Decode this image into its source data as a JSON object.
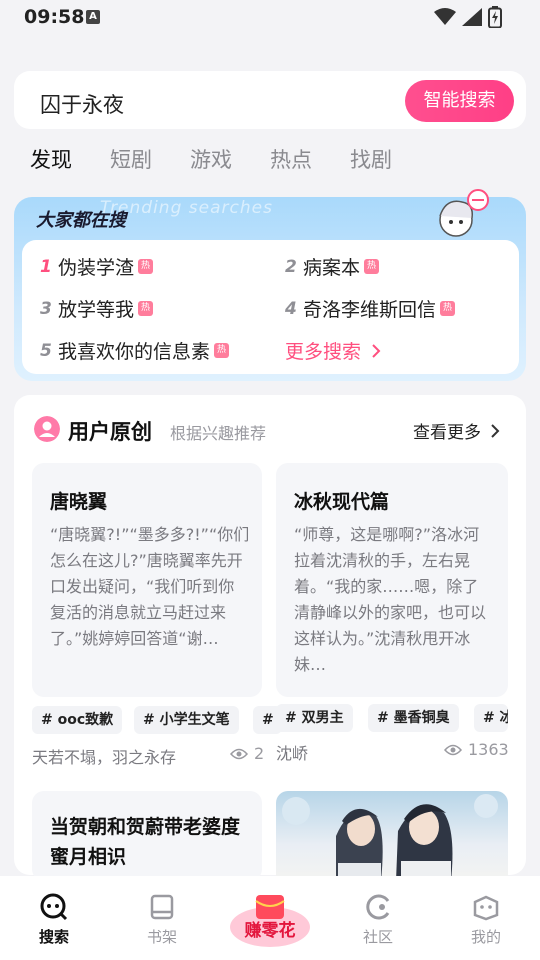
{
  "status": {
    "time": "09:58",
    "a_badge": "A"
  },
  "search": {
    "query": "囚于永夜",
    "button": "智能搜索"
  },
  "tabs": [
    "发现",
    "短剧",
    "游戏",
    "热点",
    "找剧"
  ],
  "trending": {
    "title": "大家都在搜",
    "ghost": "Trending searches",
    "hot_badge": "热",
    "items": [
      {
        "rank": "1",
        "text": "伪装学渣"
      },
      {
        "rank": "2",
        "text": "病案本"
      },
      {
        "rank": "3",
        "text": "放学等我"
      },
      {
        "rank": "4",
        "text": "奇洛李维斯回信"
      },
      {
        "rank": "5",
        "text": "我喜欢你的信息素"
      }
    ],
    "more": "更多搜索"
  },
  "creation": {
    "title": "用户原创",
    "subtitle": "根据兴趣推荐",
    "see_more": "查看更多",
    "stories": [
      {
        "title": "唐晓翼",
        "body": "“唐晓翼?!”“墨多多?!”“你们怎么在这儿?”唐晓翼率先开口发出疑问，“我们听到你复活的消息就立马赶过来了。”姚婷婷回答道“谢…",
        "tags": [
          "# ooc致歉",
          "# 小学生文笔",
          "#"
        ],
        "author": "天若不塌，羽之永存",
        "views": "2"
      },
      {
        "title": "冰秋现代篇",
        "body": "“师尊，这是哪啊?”洛冰河拉着沈清秋的手，左右晃着。“我的家……嗯，除了清静峰以外的家吧，也可以这样认为。”沈清秋甩开冰妹…",
        "tags": [
          "# 双男主",
          "# 墨香铜臭",
          "# 冰"
        ],
        "author": "沈峤",
        "views": "1363"
      },
      {
        "title": "当贺朝和贺蔚带老婆度蜜月相识"
      }
    ]
  },
  "nav": {
    "items": [
      "搜索",
      "书架",
      "赚零花",
      "社区",
      "我的"
    ]
  }
}
